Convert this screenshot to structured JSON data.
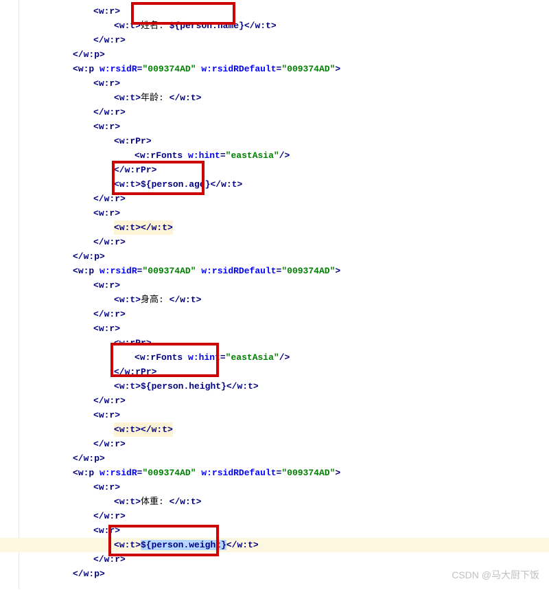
{
  "text": {
    "name_label": "姓名",
    "name_tpl": "${person.name}",
    "rsidR": "w:rsidR",
    "rsidR_val": "009374AD",
    "rsidDef": "w:rsidRDefault",
    "rsidDef_val": "009374AD",
    "age_label": "年龄: ",
    "hint": "w:hint",
    "hint_val": "eastAsia",
    "age_tpl": "${person.age}",
    "height_label": "身高: ",
    "height_tpl": "${person.height}",
    "weight_label": "体重: ",
    "weight_tpl": "${person.weight}",
    "watermark": "CSDN @马大厨下饭"
  },
  "tags": {
    "wr": "w:r",
    "wt": "w:t",
    "wp": "w:p",
    "wrPr": "w:rPr",
    "wrFonts": "w:rFonts"
  }
}
